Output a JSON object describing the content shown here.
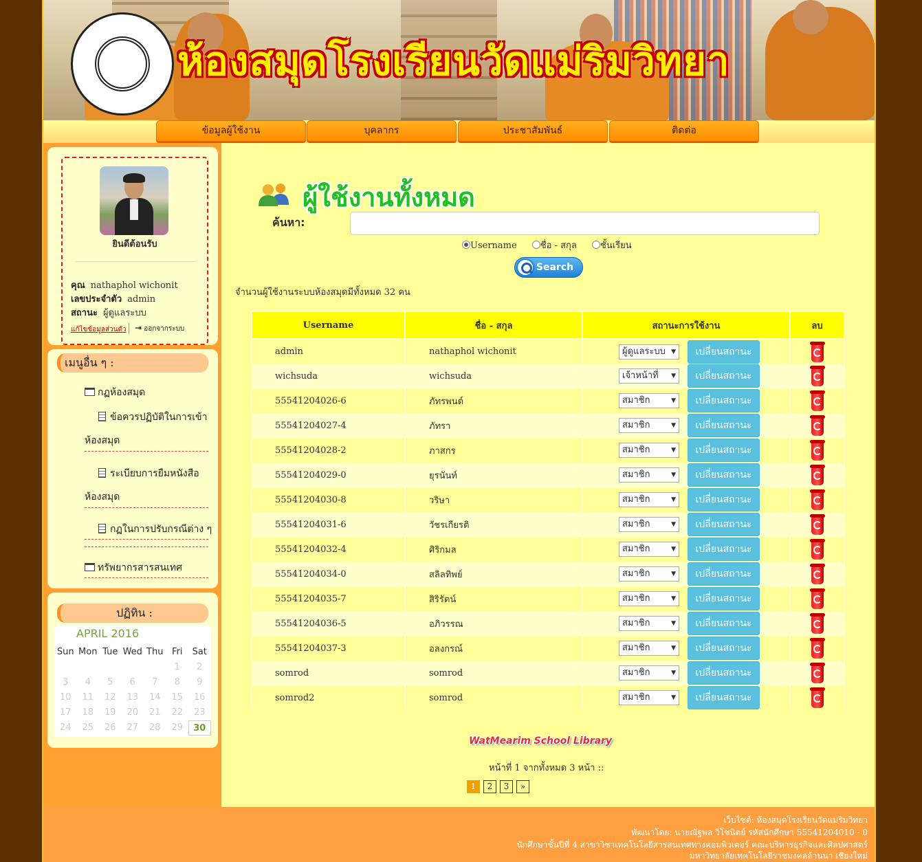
{
  "banner": {
    "title": "ห้องสมุดโรงเรียนวัดแม่ริมวิทยา"
  },
  "nav": [
    "ข้อมูลผู้ใช้งาน",
    "บุคลากร",
    "ประชาสัมพันธ์",
    "ติดต่อ"
  ],
  "profile": {
    "welcome": "ยินดีต้อนรับ",
    "name_label": "คุณ",
    "name_value": "nathaphol wichonit",
    "id_label": "เลขประจำตัว",
    "id_value": "admin",
    "status_label": "สถานะ",
    "status_value": "ผู้ดูแลระบบ",
    "edit_link": "แก้ไขข้อมูลส่วนตัว",
    "logout": "ออกจากระบบ"
  },
  "other_menu": {
    "heading": "เมนูอื่น ๆ :",
    "items": [
      "กฏห้องสมุด",
      "ข้อควรปฏิบัติในการเข้า",
      "ห้องสมุด",
      "ระเบียบการยืมหนังสือ",
      "ห้องสมุด",
      "กฏในการปรับกรณีต่าง ๆ",
      "ทรัพยากรสารสนเทศ"
    ]
  },
  "calendar": {
    "heading": "ปฏิทิน :",
    "month": "APRIL 2016",
    "weekdays": [
      "Sun",
      "Mon",
      "Tue",
      "Wed",
      "Thu",
      "Fri",
      "Sat"
    ],
    "weeks": [
      [
        "",
        "",
        "",
        "",
        "",
        "1",
        "2"
      ],
      [
        "3",
        "4",
        "5",
        "6",
        "7",
        "8",
        "9"
      ],
      [
        "10",
        "11",
        "12",
        "13",
        "14",
        "15",
        "16"
      ],
      [
        "17",
        "18",
        "19",
        "20",
        "21",
        "22",
        "23"
      ],
      [
        "24",
        "25",
        "26",
        "27",
        "28",
        "29",
        "30"
      ]
    ],
    "today": "30"
  },
  "main": {
    "title": "ผู้ใช้งานทั้งหมด",
    "search_label": "ค้นหา:",
    "search_value": "",
    "radio_options": [
      "Username",
      "ชื่อ - สกุล",
      "ชั้นเรียน"
    ],
    "radio_selected": "Username",
    "search_button": "Search",
    "user_count": "จำนวนผู้ใช้งานระบบห้องสมุดมีทั้งหมด 32 คน"
  },
  "table": {
    "headers": [
      "Username",
      "ชื่อ - สกุล",
      "สถานะการใช้งาน",
      "ลบ"
    ],
    "change_label": "เปลี่ยนสถานะ",
    "rows": [
      {
        "username": "admin",
        "name": "nathaphol wichonit",
        "status": "ผู้ดูแลระบบ"
      },
      {
        "username": "wichsuda",
        "name": "wichsuda",
        "status": "เจ้าหน้าที่"
      },
      {
        "username": "55541204026-6",
        "name": "ภัทรพนต์",
        "status": "สมาชิก"
      },
      {
        "username": "55541204027-4",
        "name": "ภัทรา",
        "status": "สมาชิก"
      },
      {
        "username": "55541204028-2",
        "name": "ภาสกร",
        "status": "สมาชิก"
      },
      {
        "username": "55541204029-0",
        "name": "ยุรนันท์",
        "status": "สมาชิก"
      },
      {
        "username": "55541204030-8",
        "name": "วริษา",
        "status": "สมาชิก"
      },
      {
        "username": "55541204031-6",
        "name": "วัชรเกียรติ",
        "status": "สมาชิก"
      },
      {
        "username": "55541204032-4",
        "name": "ศิริกมล",
        "status": "สมาชิก"
      },
      {
        "username": "55541204034-0",
        "name": "สลิลทิพย์",
        "status": "สมาชิก"
      },
      {
        "username": "55541204035-7",
        "name": "สิริรัตน์",
        "status": "สมาชิก"
      },
      {
        "username": "55541204036-5",
        "name": "อภิวรรณ",
        "status": "สมาชิก"
      },
      {
        "username": "55541204037-3",
        "name": "อลงกรณ์",
        "status": "สมาชิก"
      },
      {
        "username": "somrod",
        "name": "somrod",
        "status": "สมาชิก"
      },
      {
        "username": "somrod2",
        "name": "somrod",
        "status": "สมาชิก"
      }
    ]
  },
  "library_logo": "WatMearim School Library",
  "pagination": {
    "info": "หน้าที่ 1 จากทั้งหมด 3 หน้า ::",
    "pages": [
      "1",
      "2",
      "3",
      "»"
    ],
    "current": "1"
  },
  "footer": {
    "lines": [
      "เว็บไซต์: ห้องสมุดโรงเรียนวัดแม่ริมวิทยา",
      "พัฒนาโดย: นายณัฐพล วิโชนิตย์ รหัสนักศึกษา 55541204010 - 0",
      "นักศึกษาชั้นปีที่ 4 สาขาวิชาเทคโนโลยีสารสนเทศทางคอมพิวเตอร์ คณะบริหารธุรกิจและศิลปศาสตร์",
      "มหาวิทยาลัยเทคโนโลยีราชมงคลล้านนา เชียงใหม่"
    ]
  }
}
